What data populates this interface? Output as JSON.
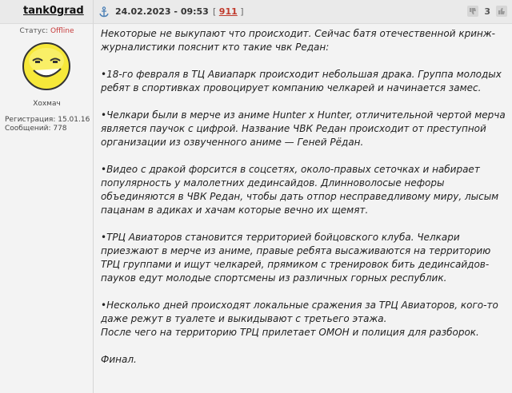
{
  "user": {
    "username": "tank0grad",
    "status_label": "Статус:",
    "status_value": "Offline",
    "rank": "Хохмач",
    "registration": "Регистрация: 15.01.16",
    "messages": "Сообщений: 778",
    "avatar_icon": "smiley-face-icon"
  },
  "post": {
    "date": "24.02.2023 - 09:53",
    "number_open": "[",
    "number": "911",
    "number_close": "]",
    "rating": "3",
    "paragraphs": [
      "Некоторые не выкупают что происходит. Сейчас батя отечественной кринж-журналистики пояснит кто такие чвк Редан:",
      "•18-го февраля в ТЦ Авиапарк происходит небольшая драка. Группа молодых ребят в спортивках провоцирует компанию челкарей и начинается замес.",
      "•Челкари были в мерче из аниме Hunter x Hunter, отличительной чертой мерча является паучок с цифрой. Название ЧВК Редан происходит от преступной организации из озвученного аниме — Геней Рёдан.",
      "•Видео с дракой форсится в соцсетях, около-правых сеточках и набирает популярность у малолетних дединсайдов. Длинноволосые нефоры объединяются в ЧВК Редан, чтобы дать отпор несправедливому миру, лысым пацанам в адиках и хачам которые вечно их щемят.",
      "•ТРЦ Авиаторов становится территорией бойцовского клуба. Челкари приезжают в мерче из аниме, правые ребята высаживаются на территорию ТРЦ группами и ищут челкарей, прямиком с тренировок бить дединсайдов-пауков едут молодые спортсмены из различных горных республик.",
      "•Несколько дней происходят локальные сражения за ТРЦ Авиаторов, кого-то даже режут в туалете и выкидывают с третьего этажа.",
      "После чего на территорию ТРЦ прилетает ОМОН и полиция для разборок.",
      "Финал."
    ]
  },
  "colors": {
    "offline": "#c73d3d",
    "post_number": "#c0392b",
    "header_bg": "#eaeaea",
    "page_bg": "#f3f3f3"
  },
  "icons": {
    "anchor": "anchor-icon",
    "rate_down": "thumb-down-icon",
    "rate_up": "thumb-up-icon"
  }
}
